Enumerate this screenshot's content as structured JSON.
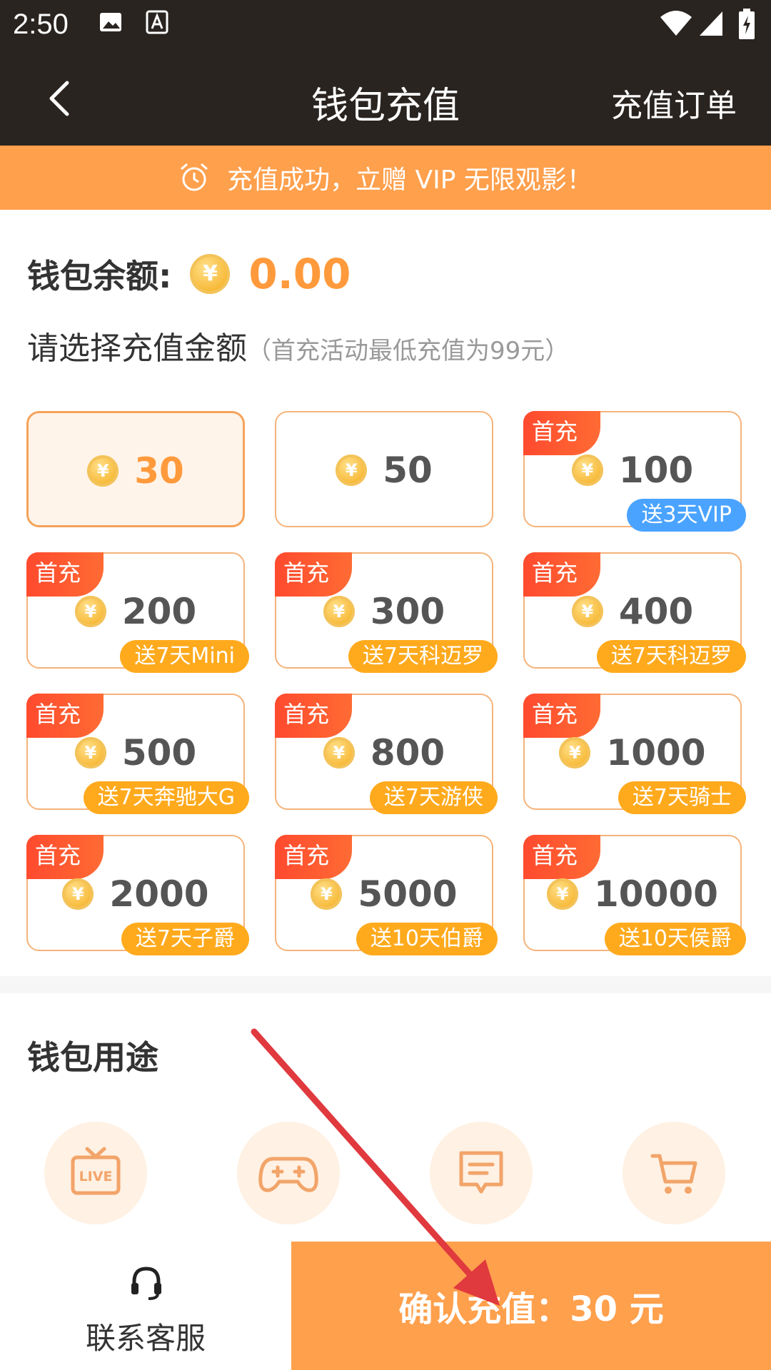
{
  "status_bar": {
    "time": "2:50"
  },
  "nav": {
    "title": "钱包充值",
    "right_link": "充值订单"
  },
  "banner": {
    "text": "充值成功，立赠 VIP 无限观影！"
  },
  "balance": {
    "label": "钱包余额:",
    "coin_symbol": "¥",
    "value": "0.00"
  },
  "select": {
    "title": "请选择充值金额",
    "hint": "（首充活动最低充值为99元）"
  },
  "first_tag": "首充",
  "packages": [
    {
      "amount": "30",
      "selected": true
    },
    {
      "amount": "50"
    },
    {
      "amount": "100",
      "first": true,
      "bonus": "送3天VIP",
      "bonus_color": "#4aa3ff"
    },
    {
      "amount": "200",
      "first": true,
      "bonus": "送7天Mini"
    },
    {
      "amount": "300",
      "first": true,
      "bonus": "送7天科迈罗"
    },
    {
      "amount": "400",
      "first": true,
      "bonus": "送7天科迈罗"
    },
    {
      "amount": "500",
      "first": true,
      "bonus": "送7天奔驰大G"
    },
    {
      "amount": "800",
      "first": true,
      "bonus": "送7天游侠"
    },
    {
      "amount": "1000",
      "first": true,
      "bonus": "送7天骑士"
    },
    {
      "amount": "2000",
      "first": true,
      "bonus": "送7天子爵"
    },
    {
      "amount": "5000",
      "first": true,
      "bonus": "送10天伯爵"
    },
    {
      "amount": "10000",
      "first": true,
      "bonus": "送10天侯爵"
    }
  ],
  "usage": {
    "title": "钱包用途",
    "items": [
      {
        "icon": "live-tv-icon"
      },
      {
        "icon": "gamepad-icon"
      },
      {
        "icon": "message-icon"
      },
      {
        "icon": "cart-icon"
      }
    ]
  },
  "bottom": {
    "service_label": "联系客服",
    "confirm_label": "确认充值：30 元"
  },
  "colors": {
    "accent": "#ffa04d",
    "header": "#2a2420",
    "first_tag": "#ff4a2e",
    "bonus": "#ffaa1d",
    "annotation_arrow": "#e0393e"
  }
}
